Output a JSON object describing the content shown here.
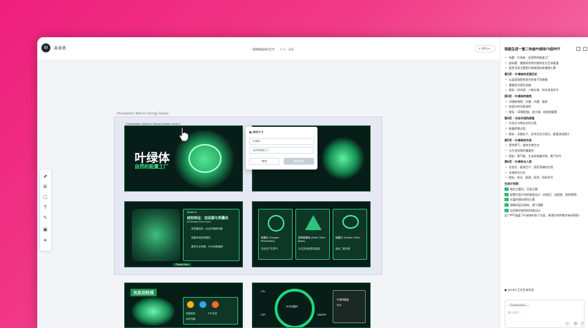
{
  "app": {
    "avatar": "W",
    "title": "未命名",
    "doc_name": "植物能量绿色文字",
    "doc_size": "8 m",
    "doc_action": "画板",
    "zoom": "46%"
  },
  "canvas": {
    "board_label": "Chloroplasts: Nature's Energy Factory",
    "selected_label": "Chloroplasts: Nature's Energy Factory_slide_1",
    "slide1": {
      "title": "叶绿体",
      "subtitle": "自然的能量工厂"
    },
    "slide3": {
      "heading": "Space A",
      "title": "结构特征：双层膜与类囊体",
      "en": "(Intimate Structure)",
      "items": [
        "双层膜结构，包含外膜和内膜",
        "类囊体堆叠成基粒",
        "基质中含有酶、DNA和核糖体"
      ],
      "button": "Thank You"
    },
    "slide4": {
      "cards": [
        {
          "title": "类囊体 (Oxygen Production)",
          "desc": "光反应产生氧气"
        },
        {
          "title": "食物链基础 (Food Chain Base)",
          "desc": "为生态系统提供能量"
        },
        {
          "title": "碳循环 (Carbon Sink)",
          "desc": "吸收二氧化碳"
        }
      ]
    },
    "slide5": {
      "title": "光反应阶段",
      "steps": [
        "光能吸收",
        "水的光解",
        "ATP生成"
      ]
    },
    "slide6": {
      "center": "卡尔文循环",
      "labels": [
        "CO₂",
        "ATP",
        "NADPH"
      ],
      "card_title": "叶绿体能量",
      "card_sub": "转化"
    }
  },
  "popup": {
    "title": "编辑文字",
    "field1": "叶绿体",
    "field2": "自然的能量工厂",
    "cancel": "取消",
    "ok": "确认修改"
  },
  "chat": {
    "header": "根据生成一套二年级叶绿体介绍PPT",
    "lines": [
      {
        "t": "b",
        "s": "标题：叶绿体 · 自然界的能量工厂"
      },
      {
        "t": "b",
        "s": "副标题：植物如何将光能转化为生命能量"
      },
      {
        "t": "b",
        "s": "配色采用主题色叶绿体图标和植物元素"
      },
      {
        "t": "h",
        "s": "第2页 - 叶绿体的发现历史"
      },
      {
        "t": "b",
        "s": "从英国观察到现代的电子显微镜"
      },
      {
        "t": "b",
        "s": "重要科学家的贡献"
      },
      {
        "t": "b",
        "s": "图标：时间线、人物头像、科学发现符号"
      },
      {
        "t": "h",
        "s": "第3页 - 叶绿体的结构"
      },
      {
        "t": "b",
        "s": "详细结构图：外膜、内膜、基质"
      },
      {
        "t": "b",
        "s": "各部分的功能说明"
      },
      {
        "t": "b",
        "s": "图标：3D模型图、放大镜、结构图要素"
      },
      {
        "t": "h",
        "s": "第4页 - 光合作用的原理"
      },
      {
        "t": "b",
        "s": "光反应与暗反应的过程"
      },
      {
        "t": "b",
        "s": "能量转换过程"
      },
      {
        "t": "b",
        "s": "图标：光能粒子、化学反应方程式、能量流动图示"
      },
      {
        "t": "h",
        "s": "第5页 - 叶绿体的作用"
      },
      {
        "t": "b",
        "s": "提供氧气，维持生物生存"
      },
      {
        "t": "b",
        "s": "与生态系统的重要性"
      },
      {
        "t": "b",
        "s": "图标：氧气图、生态系统循环图、氧气符号"
      },
      {
        "t": "h",
        "s": "第6页 - 叶绿体与人类"
      },
      {
        "t": "b",
        "s": "在农业、能源生产、医药领域的应用"
      },
      {
        "t": "b",
        "s": "未来研究方向"
      },
      {
        "t": "b",
        "s": "图标：农业、能源、医药、科研符号"
      },
      {
        "t": "h",
        "s": "生成计划表："
      },
      {
        "t": "c",
        "s": "制定主题风、目录主题"
      },
      {
        "t": "c",
        "s": "配置页面不同的版面设计（封面页、流程图、结构图等）"
      },
      {
        "t": "c",
        "s": "丰富的图标视觉元素"
      },
      {
        "t": "c",
        "s": "清晰的层次结构，便于理解"
      },
      {
        "t": "c",
        "s": "适合教学使用的排版设计"
      },
      {
        "t": "p",
        "s": "这个PPT涵盖了叶绿体的各个方面，希望对你的教学有所帮助！"
      }
    ],
    "ref": "Lovart 正在生成任务",
    "chip": "Chloroplasts...",
    "placeholder": "输入指令..."
  }
}
